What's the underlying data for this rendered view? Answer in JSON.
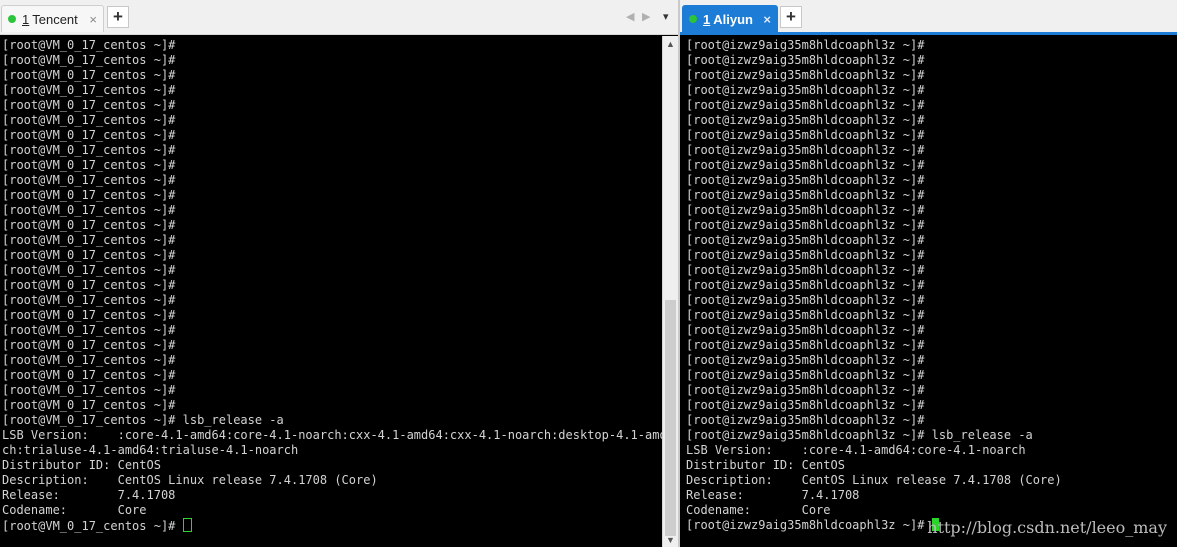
{
  "left": {
    "tab": {
      "num": "1",
      "label": "Tencent",
      "close": "×"
    },
    "newtab": "+",
    "nav": {
      "prev": "◀",
      "next": "▶",
      "menu": "▾"
    },
    "prompt": "[root@VM_0_17_centos ~]#",
    "lines": [
      "[root@VM_0_17_centos ~]#",
      "[root@VM_0_17_centos ~]#",
      "[root@VM_0_17_centos ~]#",
      "[root@VM_0_17_centos ~]#",
      "[root@VM_0_17_centos ~]#",
      "[root@VM_0_17_centos ~]#",
      "[root@VM_0_17_centos ~]#",
      "[root@VM_0_17_centos ~]#",
      "[root@VM_0_17_centos ~]#",
      "[root@VM_0_17_centos ~]#",
      "[root@VM_0_17_centos ~]#",
      "[root@VM_0_17_centos ~]#",
      "[root@VM_0_17_centos ~]#",
      "[root@VM_0_17_centos ~]#",
      "[root@VM_0_17_centos ~]#",
      "[root@VM_0_17_centos ~]#",
      "[root@VM_0_17_centos ~]#",
      "[root@VM_0_17_centos ~]#",
      "[root@VM_0_17_centos ~]#",
      "[root@VM_0_17_centos ~]#",
      "[root@VM_0_17_centos ~]#",
      "[root@VM_0_17_centos ~]#",
      "[root@VM_0_17_centos ~]#",
      "[root@VM_0_17_centos ~]#",
      "[root@VM_0_17_centos ~]#",
      "[root@VM_0_17_centos ~]# lsb_release -a",
      "LSB Version:    :core-4.1-amd64:core-4.1-noarch:cxx-4.1-amd64:cxx-4.1-noarch:desktop-4.1-amd6",
      "ch:trialuse-4.1-amd64:trialuse-4.1-noarch",
      "Distributor ID: CentOS",
      "Description:    CentOS Linux release 7.4.1708 (Core)",
      "Release:        7.4.1708",
      "Codename:       Core"
    ]
  },
  "right": {
    "tab": {
      "num": "1",
      "label": "Aliyun",
      "close": "×"
    },
    "newtab": "+",
    "prompt": "[root@izwz9aig35m8hldcoaphl3z ~]#",
    "lines": [
      "[root@izwz9aig35m8hldcoaphl3z ~]#",
      "[root@izwz9aig35m8hldcoaphl3z ~]#",
      "[root@izwz9aig35m8hldcoaphl3z ~]#",
      "[root@izwz9aig35m8hldcoaphl3z ~]#",
      "[root@izwz9aig35m8hldcoaphl3z ~]#",
      "[root@izwz9aig35m8hldcoaphl3z ~]#",
      "[root@izwz9aig35m8hldcoaphl3z ~]#",
      "[root@izwz9aig35m8hldcoaphl3z ~]#",
      "[root@izwz9aig35m8hldcoaphl3z ~]#",
      "[root@izwz9aig35m8hldcoaphl3z ~]#",
      "[root@izwz9aig35m8hldcoaphl3z ~]#",
      "[root@izwz9aig35m8hldcoaphl3z ~]#",
      "[root@izwz9aig35m8hldcoaphl3z ~]#",
      "[root@izwz9aig35m8hldcoaphl3z ~]#",
      "[root@izwz9aig35m8hldcoaphl3z ~]#",
      "[root@izwz9aig35m8hldcoaphl3z ~]#",
      "[root@izwz9aig35m8hldcoaphl3z ~]#",
      "[root@izwz9aig35m8hldcoaphl3z ~]#",
      "[root@izwz9aig35m8hldcoaphl3z ~]#",
      "[root@izwz9aig35m8hldcoaphl3z ~]#",
      "[root@izwz9aig35m8hldcoaphl3z ~]#",
      "[root@izwz9aig35m8hldcoaphl3z ~]#",
      "[root@izwz9aig35m8hldcoaphl3z ~]#",
      "[root@izwz9aig35m8hldcoaphl3z ~]#",
      "[root@izwz9aig35m8hldcoaphl3z ~]#",
      "[root@izwz9aig35m8hldcoaphl3z ~]#",
      "[root@izwz9aig35m8hldcoaphl3z ~]# lsb_release -a",
      "LSB Version:    :core-4.1-amd64:core-4.1-noarch",
      "Distributor ID: CentOS",
      "Description:    CentOS Linux release 7.4.1708 (Core)",
      "Release:        7.4.1708",
      "Codename:       Core"
    ]
  },
  "watermark": "http://blog.csdn.net/leeo_may",
  "colors": {
    "accent": "#1c7cd6",
    "status_green": "#2bc43a",
    "cursor": "#2bd32b"
  }
}
